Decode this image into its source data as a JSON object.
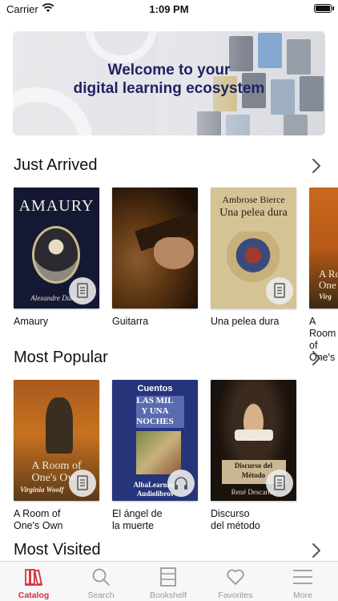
{
  "status_bar": {
    "carrier": "Carrier",
    "time": "1:09 PM",
    "wifi_icon": "wifi-icon",
    "battery_icon": "battery-icon"
  },
  "banner": {
    "line1": "Welcome to your",
    "line2": "digital learning ecosystem"
  },
  "sections": {
    "just_arrived": {
      "title": "Just Arrived",
      "books": [
        {
          "title": "Amaury",
          "cover_title": "AMAURY",
          "cover_author": "Alexandre Dumas",
          "badge_icon": "document-icon"
        },
        {
          "title": "Guitarra",
          "badge_icon": ""
        },
        {
          "title": "Una pelea dura",
          "cover_author": "Ambrose Bierce",
          "cover_title": "Una pelea dura",
          "badge_icon": "document-icon"
        },
        {
          "title": "A Room of One's",
          "cover_title": "A Roo",
          "cover_subtitle": "One",
          "cover_author": "Virg",
          "badge_icon": ""
        }
      ]
    },
    "most_popular": {
      "title": "Most Popular",
      "books": [
        {
          "title": "A Room of",
          "title2": "One's Own",
          "cover_title": "A Room of",
          "cover_title2": "One's Own",
          "cover_author": "Virginia Woolf",
          "badge_icon": "document-icon"
        },
        {
          "title": "El ángel de",
          "title2": "la muerte",
          "cover_header": "Cuentos",
          "cover_title": "LAS MIL",
          "cover_title2": "Y UNA",
          "cover_title3": "NOCHES",
          "cover_footer": "AlbaLearning",
          "cover_footer2": "Audiolibros",
          "badge_icon": "headphones-icon"
        },
        {
          "title": "Discurso",
          "title2": "del método",
          "cover_title": "Discurso del",
          "cover_title2": "Método",
          "cover_author": "René Descartes",
          "badge_icon": "document-icon"
        }
      ]
    },
    "most_visited": {
      "title": "Most Visited"
    }
  },
  "tabs": [
    {
      "label": "Catalog",
      "icon": "books-icon",
      "active": true
    },
    {
      "label": "Search",
      "icon": "search-icon",
      "active": false
    },
    {
      "label": "Bookshelf",
      "icon": "bookshelf-icon",
      "active": false
    },
    {
      "label": "Favorites",
      "icon": "heart-icon",
      "active": false
    },
    {
      "label": "More",
      "icon": "menu-icon",
      "active": false
    }
  ],
  "colors": {
    "accent": "#d9303a",
    "banner_text": "#1f2364",
    "inactive_tab": "#9a9a9a"
  }
}
